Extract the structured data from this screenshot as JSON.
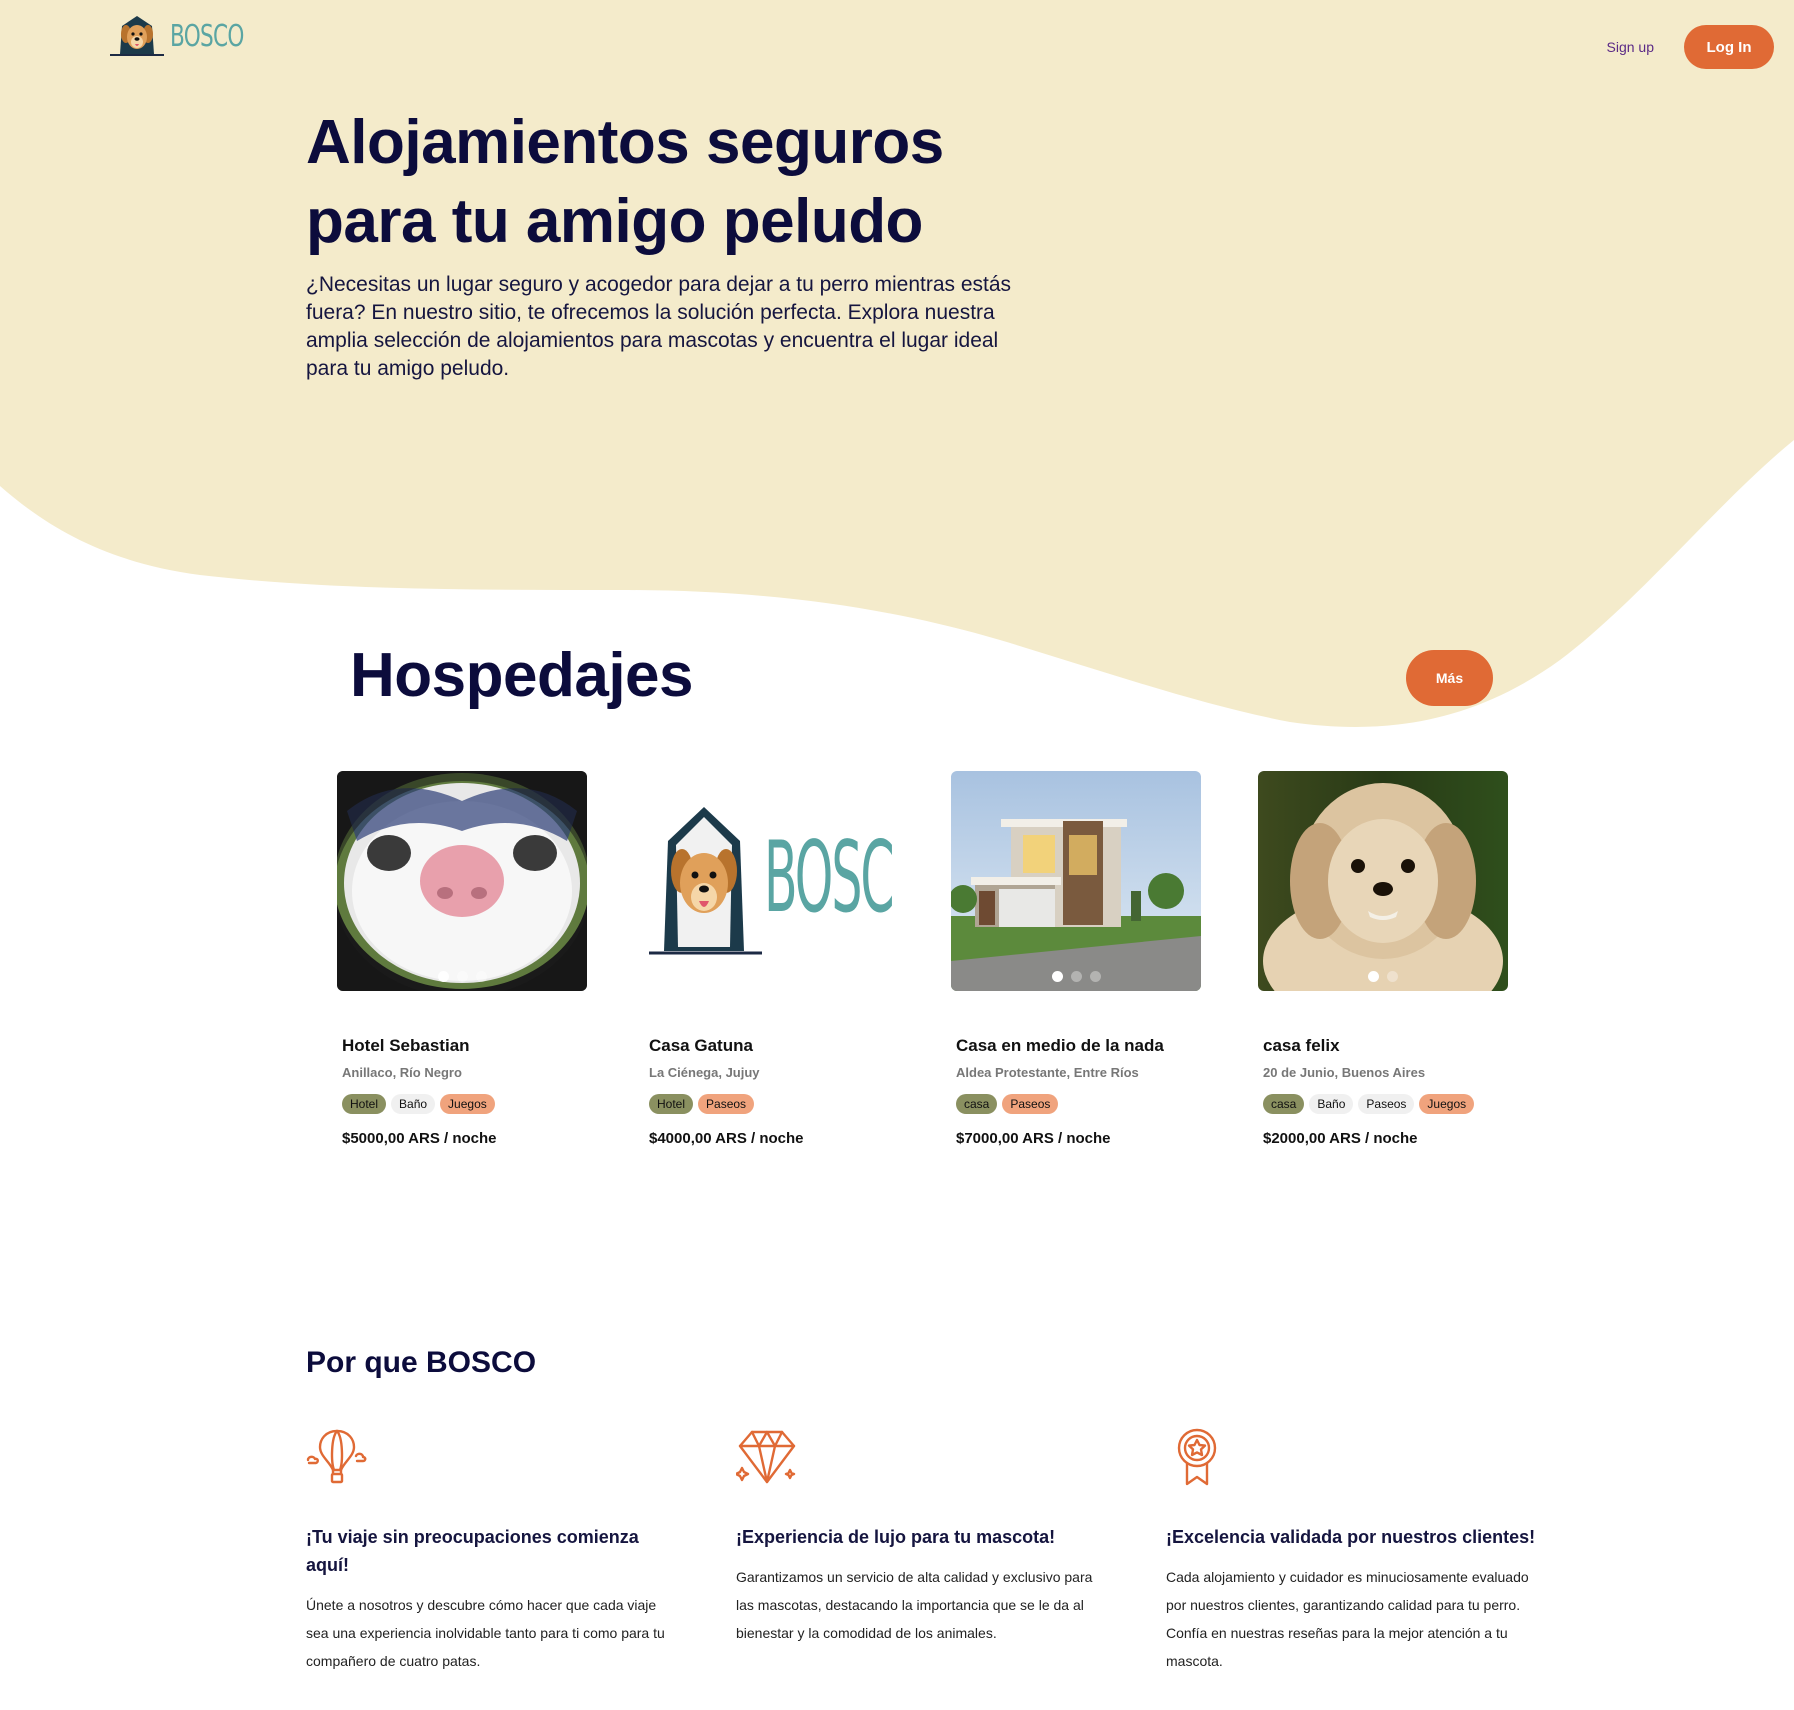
{
  "colors": {
    "hero_bg": "#f4ebcb",
    "accent": "#e06a35",
    "heading": "#0c0c3c",
    "logo_teal": "#5aa5a3"
  },
  "brand": {
    "name": "BOSCO",
    "logo_icon": "dog-head-icon"
  },
  "nav": {
    "signup_label": "Sign up",
    "login_label": "Log In"
  },
  "hero": {
    "title": "Alojamientos seguros para tu amigo peludo",
    "description": "¿Necesitas un lugar seguro y acogedor para dejar a tu perro mientras estás fuera? En nuestro sitio, te ofrecemos la solución perfecta. Explora nuestra amplia selección de alojamientos para mascotas y encuentra el lugar ideal para tu amigo peludo."
  },
  "listings": {
    "title": "Hospedajes",
    "more_label": "Más",
    "items": [
      {
        "name": "Hotel Sebastian",
        "location": "Anillaco, Río Negro",
        "tags": [
          "Hotel",
          "Baño",
          "Juegos"
        ],
        "price": "$5000,00 ARS / noche",
        "image": "cat-closeup-photo"
      },
      {
        "name": "Casa Gatuna",
        "location": "La Ciénega, Jujuy",
        "tags": [
          "Hotel",
          "Paseos"
        ],
        "price": "$4000,00 ARS / noche",
        "image": "bosco-logo-image",
        "logo_text": "BOSCO"
      },
      {
        "name": "Casa en medio de la nada",
        "location": "Aldea Protestante, Entre Ríos",
        "tags": [
          "casa",
          "Paseos"
        ],
        "price": "$7000,00 ARS / noche",
        "image": "modern-house-photo"
      },
      {
        "name": "casa felix",
        "location": "20 de Junio, Buenos Aires",
        "tags": [
          "casa",
          "Baño",
          "Paseos",
          "Juegos"
        ],
        "price": "$2000,00 ARS / noche",
        "image": "dog-photo"
      }
    ]
  },
  "why": {
    "title": "Por que BOSCO",
    "features": [
      {
        "icon": "hot-air-balloon-icon",
        "title": "¡Tu viaje sin preocupaciones comienza aquí!",
        "description": "Únete a nosotros y descubre cómo hacer que cada viaje sea una experiencia inolvidable tanto para ti como para tu compañero de cuatro patas."
      },
      {
        "icon": "diamond-icon",
        "title": "¡Experiencia de lujo para tu mascota!",
        "description": "Garantizamos un servicio de alta calidad y exclusivo para las mascotas, destacando la importancia que se le da al bienestar y la comodidad de los animales."
      },
      {
        "icon": "award-ribbon-icon",
        "title": "¡Excelencia validada por nuestros clientes!",
        "description": "Cada alojamiento y cuidador es minuciosamente evaluado por nuestros clientes, garantizando calidad para tu perro. Confía en nuestras reseñas para la mejor atención a tu mascota."
      }
    ]
  }
}
